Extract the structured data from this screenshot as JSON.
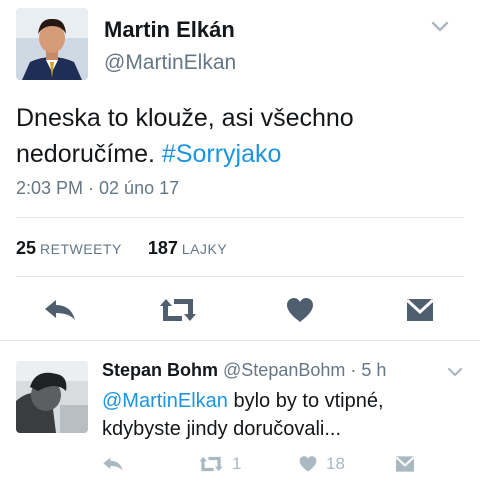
{
  "tweet": {
    "author_name": "Martin Elkán",
    "author_handle": "@MartinElkan",
    "text_plain": "Dneska to klouže, asi všechno nedoručíme.",
    "hashtag": "#Sorryjako",
    "timestamp": "2:03 PM · 02 úno 17",
    "retweets_count": "25",
    "retweets_label": "RETWEETY",
    "likes_count": "187",
    "likes_label": "LAJKY",
    "icons": [
      "reply-icon",
      "retweet-icon",
      "heart-icon",
      "message-icon",
      "chevron-down-icon"
    ]
  },
  "reply": {
    "author_name": "Stepan Bohm",
    "author_handle": "@StepanBohm",
    "time": "· 5 h",
    "mention": "@MartinElkan",
    "text_rest": " bylo by to vtipné, kdybyste jindy doručovali...",
    "retweet_count": "1",
    "like_count": "18"
  },
  "colors": {
    "link": "#1b95e0",
    "secondary_text": "#657786",
    "main_icon": "#4f5f6f",
    "reply_icon": "#aab8c2",
    "divider": "#e1e8ed"
  }
}
